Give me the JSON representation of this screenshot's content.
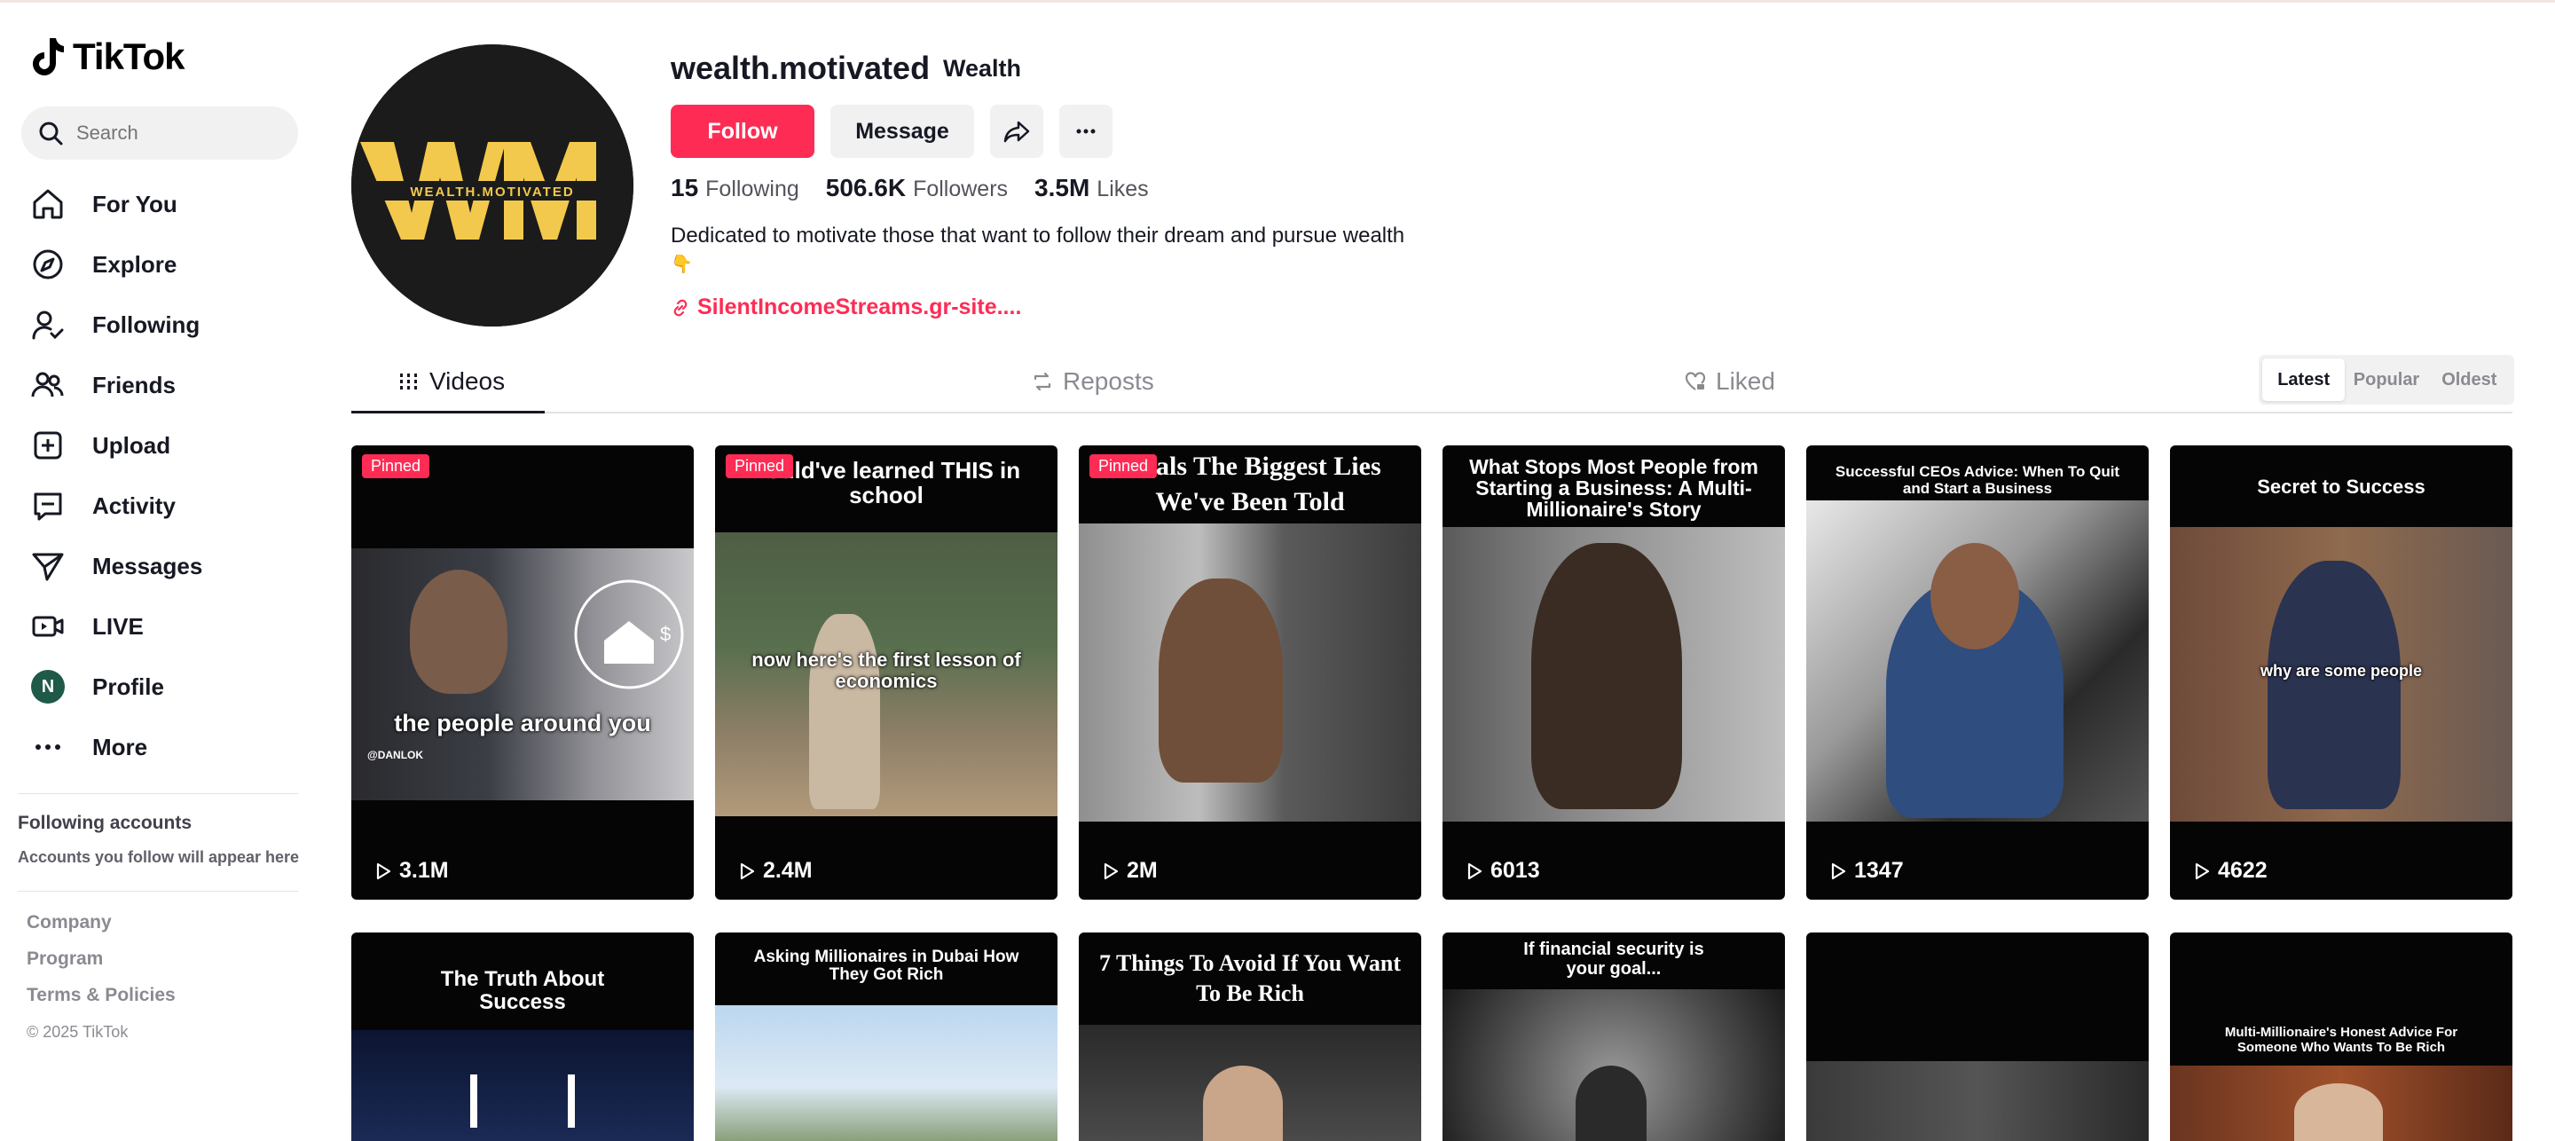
{
  "brand": {
    "name": "TikTok"
  },
  "search": {
    "placeholder": "Search"
  },
  "sidebar": {
    "items": [
      {
        "label": "For You",
        "icon": "home-icon"
      },
      {
        "label": "Explore",
        "icon": "compass-icon"
      },
      {
        "label": "Following",
        "icon": "user-follow-icon"
      },
      {
        "label": "Friends",
        "icon": "friends-icon"
      },
      {
        "label": "Upload",
        "icon": "plus-square-icon"
      },
      {
        "label": "Activity",
        "icon": "message-square-icon"
      },
      {
        "label": "Messages",
        "icon": "send-icon"
      },
      {
        "label": "LIVE",
        "icon": "live-camera-icon"
      },
      {
        "label": "Profile",
        "icon": "avatar-n",
        "avatar_letter": "N"
      },
      {
        "label": "More",
        "icon": "more-dots-icon"
      }
    ],
    "following_accounts": {
      "title": "Following accounts",
      "subtitle": "Accounts you follow will appear here"
    },
    "footer": {
      "links": [
        "Company",
        "Program",
        "Terms & Policies"
      ],
      "copyright": "© 2025 TikTok"
    }
  },
  "profile": {
    "username": "wealth.motivated",
    "nickname": "Wealth",
    "avatar_text": "WEALTH.MOTIVATED",
    "follow_label": "Follow",
    "message_label": "Message",
    "stats": {
      "following": "15",
      "following_label": "Following",
      "followers": "506.6K",
      "followers_label": "Followers",
      "likes": "3.5M",
      "likes_label": "Likes"
    },
    "bio": "Dedicated to motivate those that want to follow their dream and pursue wealth",
    "bio_emoji": "👇",
    "link": "SilentIncomeStreams.gr-site...."
  },
  "tabs": [
    {
      "label": "Videos",
      "active": true
    },
    {
      "label": "Reposts",
      "active": false
    },
    {
      "label": "Liked",
      "active": false
    }
  ],
  "sort": {
    "options": [
      "Latest",
      "Popular",
      "Oldest"
    ],
    "selected": "Latest"
  },
  "videos": [
    {
      "pinned": "Pinned",
      "title": "",
      "overlay": "the people around you",
      "watermark": "@DANLOK",
      "views": "3.1M"
    },
    {
      "pinned": "Pinned",
      "title": "hould've learned THIS in school",
      "overlay": "now here's the first lesson of economics",
      "views": "2.4M"
    },
    {
      "pinned": "Pinned",
      "title": "eveals The Biggest Lies We've Been Told",
      "overlay": "",
      "views": "2M"
    },
    {
      "pinned": "",
      "title": "What Stops Most People from Starting a Business: A Multi-Millionaire's Story",
      "overlay": "",
      "views": "6013"
    },
    {
      "pinned": "",
      "title": "Successful CEOs Advice: When To Quit and Start a Business",
      "overlay": "",
      "views": "1347"
    },
    {
      "pinned": "",
      "title": "Secret to Success",
      "overlay": "why are some people",
      "views": "4622"
    },
    {
      "pinned": "",
      "title": "The Truth About Success",
      "overlay": "",
      "views": ""
    },
    {
      "pinned": "",
      "title": "Asking Millionaires in Dubai How They Got Rich",
      "overlay": "",
      "views": ""
    },
    {
      "pinned": "",
      "title": "7 Things To Avoid If You Want To Be Rich",
      "overlay": "",
      "views": ""
    },
    {
      "pinned": "",
      "title": "If financial security is your goal...",
      "overlay": "",
      "views": ""
    },
    {
      "pinned": "",
      "title": "",
      "overlay": "",
      "views": ""
    },
    {
      "pinned": "",
      "title": "Multi-Millionaire's Honest Advice For Someone Who Wants To Be Rich",
      "overlay": "",
      "views": ""
    }
  ],
  "colors": {
    "accent": "#fe2c55",
    "text": "#161823",
    "muted": "#8a8b91",
    "gold": "#f2c94c"
  }
}
